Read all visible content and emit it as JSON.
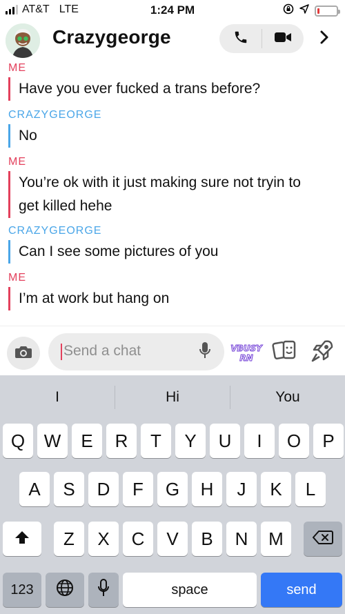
{
  "status_bar": {
    "carrier": "AT&T",
    "network": "LTE",
    "time": "1:24 PM",
    "battery_level": 0.12,
    "icons": [
      "lock-rotation-icon",
      "location-arrow-icon"
    ]
  },
  "header": {
    "title": "Crazygeorge",
    "call_icon": "phone-icon",
    "video_icon": "video-camera-icon",
    "next_icon": "chevron-right-icon"
  },
  "messages": [
    {
      "sender": "ME",
      "from": "me",
      "lines": [
        "Have you ever fucked a trans before?"
      ]
    },
    {
      "sender": "CRAZYGEORGE",
      "from": "them",
      "lines": [
        "No"
      ]
    },
    {
      "sender": "ME",
      "from": "me",
      "lines": [
        "You’re ok with it just making sure not tryin to",
        "get killed hehe"
      ]
    },
    {
      "sender": "CRAZYGEORGE",
      "from": "them",
      "lines": [
        "Can I see some pictures of you"
      ]
    },
    {
      "sender": "ME",
      "from": "me",
      "lines": [
        "I’m at work but hang on"
      ]
    }
  ],
  "composer": {
    "placeholder": "Send a chat",
    "bitmoji_text_1": "VBUSY",
    "bitmoji_text_2": "RN"
  },
  "keyboard": {
    "suggestions": [
      "I",
      "Hi",
      "You"
    ],
    "row1": [
      "Q",
      "W",
      "E",
      "R",
      "T",
      "Y",
      "U",
      "I",
      "O",
      "P"
    ],
    "row2": [
      "A",
      "S",
      "D",
      "F",
      "G",
      "H",
      "J",
      "K",
      "L"
    ],
    "row3": [
      "Z",
      "X",
      "C",
      "V",
      "B",
      "N",
      "M"
    ],
    "numbers_label": "123",
    "space_label": "space",
    "send_label": "send"
  },
  "colors": {
    "me": "#e3405c",
    "them": "#4aa6e8",
    "send": "#3478f6",
    "keyboard_bg": "#d1d4da"
  }
}
